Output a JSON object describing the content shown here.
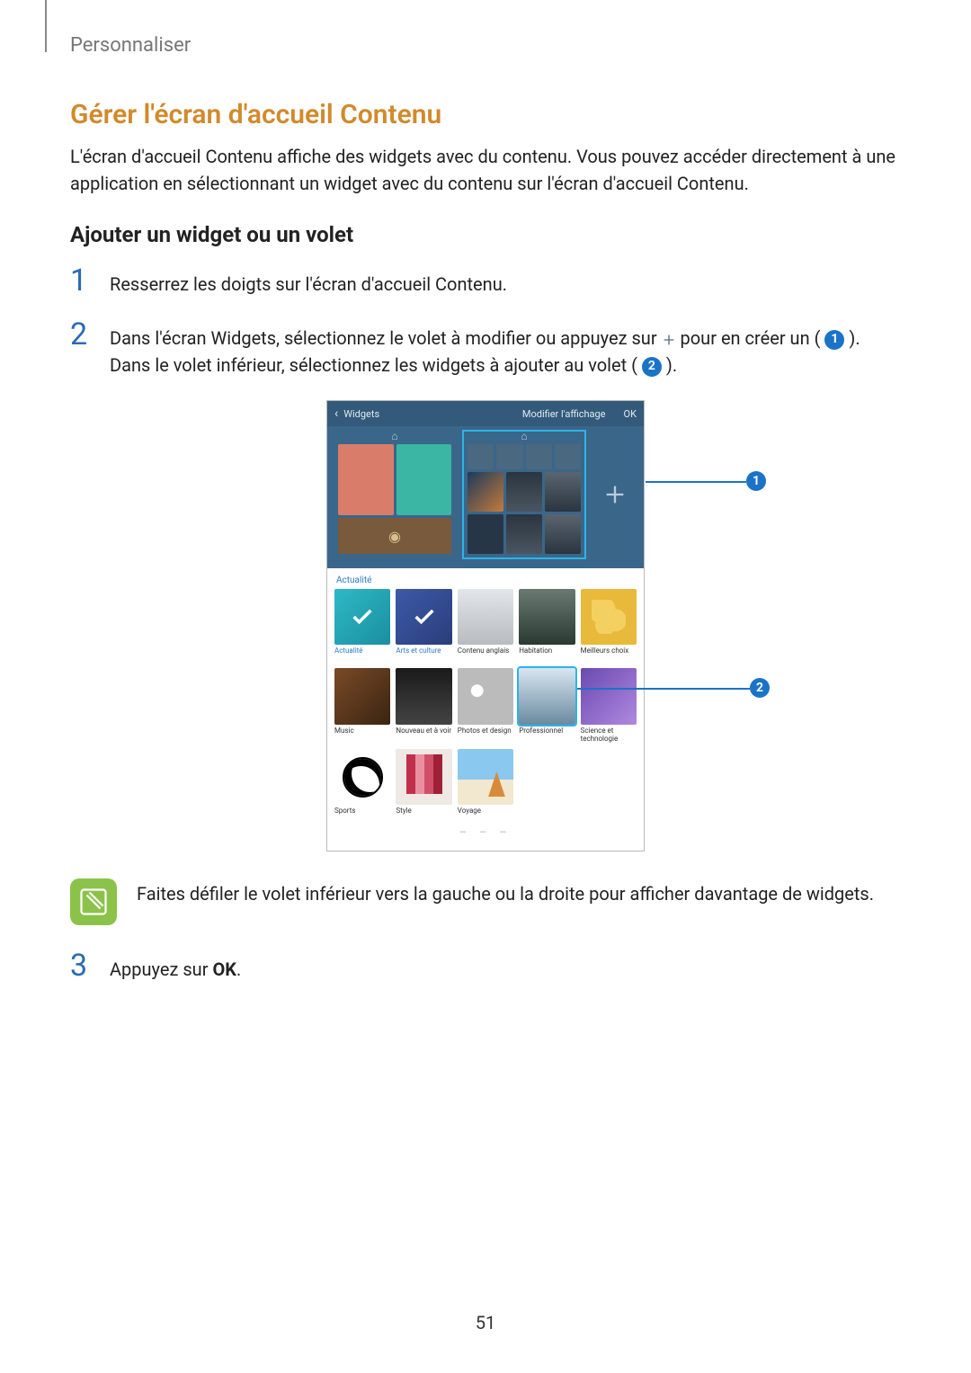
{
  "breadcrumb": "Personnaliser",
  "heading": "Gérer l'écran d'accueil Contenu",
  "intro": "L'écran d'accueil Contenu affiche des widgets avec du contenu. Vous pouvez accéder directement à une application en sélectionnant un widget avec du contenu sur l'écran d'accueil Contenu.",
  "subheading": "Ajouter un widget ou un volet",
  "steps": {
    "n1": "1",
    "s1": "Resserrez les doigts sur l'écran d'accueil Contenu.",
    "n2": "2",
    "s2a": "Dans l'écran Widgets, sélectionnez le volet à modifier ou appuyez sur ",
    "s2b": " pour en créer un ( ",
    "s2c": " ).",
    "s2d": "Dans le volet inférieur, sélectionnez les widgets à ajouter au volet ( ",
    "s2e": " ).",
    "n3": "3",
    "s3a": "Appuyez sur ",
    "s3b": "OK",
    "s3c": "."
  },
  "callouts": {
    "c1": "1",
    "c2": "2"
  },
  "tablet": {
    "back": "Widgets",
    "modify": "Modifier l'affichage",
    "ok": "OK",
    "section": "Actualité",
    "widgets": [
      {
        "label": "Actualité",
        "cls": "t-actualite",
        "labelBlue": true,
        "checked": true
      },
      {
        "label": "Arts et culture",
        "cls": "t-arts",
        "labelBlue": true,
        "checked": true
      },
      {
        "label": "Contenu anglais",
        "cls": "t-contenu"
      },
      {
        "label": "Habitation",
        "cls": "t-habitation"
      },
      {
        "label": "Meilleurs choix",
        "cls": "t-meilleurs"
      },
      {
        "label": "Music",
        "cls": "t-music"
      },
      {
        "label": "Nouveau et à voir",
        "cls": "t-nouveau"
      },
      {
        "label": "Photos et design",
        "cls": "t-photos"
      },
      {
        "label": "Professionnel",
        "cls": "t-profession",
        "highlight": true
      },
      {
        "label": "Science et technologie",
        "cls": "t-science"
      },
      {
        "label": "Sports",
        "cls": "t-sports"
      },
      {
        "label": "Style",
        "cls": "t-style"
      },
      {
        "label": "Voyage",
        "cls": "t-voyage"
      }
    ]
  },
  "note": "Faites défiler le volet inférieur vers la gauche ou la droite pour afficher davantage de widgets.",
  "pageNum": "51"
}
